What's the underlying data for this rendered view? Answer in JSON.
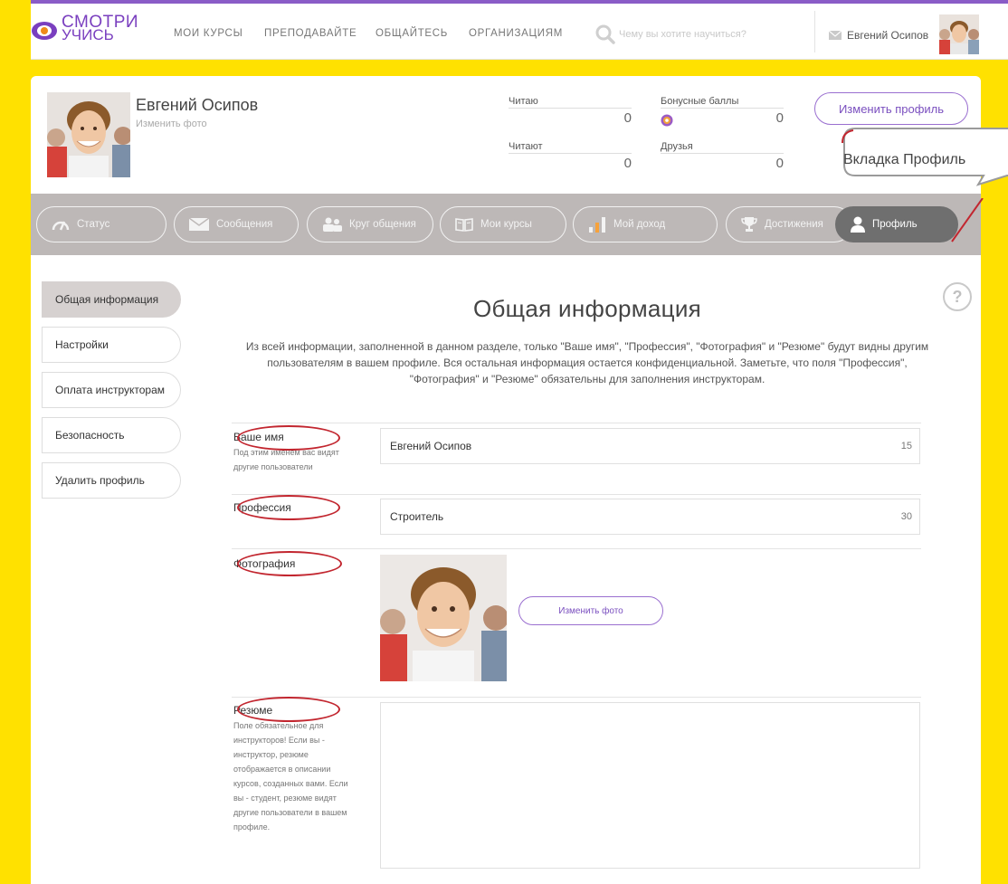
{
  "logo": {
    "line1": "СМОТРИ",
    "line2": "УЧИСЬ"
  },
  "nav": {
    "items": [
      "МОИ КУРСЫ",
      "ПРЕПОДАВАЙТЕ",
      "ОБЩАЙТЕСЬ",
      "ОРГАНИЗАЦИЯМ"
    ]
  },
  "search": {
    "placeholder": "Чему вы хотите научиться?"
  },
  "header_user": {
    "name": "Евгений Осипов"
  },
  "profile": {
    "name": "Евгений Осипов",
    "change_photo": "Изменить фото",
    "stats": [
      {
        "label": "Читаю",
        "value": "0"
      },
      {
        "label": "Бонусные баллы",
        "value": "0"
      },
      {
        "label": "Читают",
        "value": "0"
      },
      {
        "label": "Друзья",
        "value": "0"
      }
    ],
    "edit_button": "Изменить профиль"
  },
  "callout": {
    "text": "Вкладка Профиль"
  },
  "tabs": [
    {
      "label": "Статус",
      "icon": "speedometer-icon",
      "active": false
    },
    {
      "label": "Сообщения",
      "icon": "envelope-icon",
      "active": false
    },
    {
      "label": "Круг общения",
      "icon": "people-icon",
      "active": false
    },
    {
      "label": "Мои курсы",
      "icon": "book-icon",
      "active": false
    },
    {
      "label": "Мой доход",
      "icon": "bars-icon",
      "active": false
    },
    {
      "label": "Достижения",
      "icon": "trophy-icon",
      "active": false
    },
    {
      "label": "Профиль",
      "icon": "person-icon",
      "active": true
    }
  ],
  "sidebar": {
    "items": [
      {
        "label": "Общая информация",
        "active": true
      },
      {
        "label": "Настройки",
        "active": false
      },
      {
        "label": "Оплата инструкторам",
        "active": false
      },
      {
        "label": "Безопасность",
        "active": false
      },
      {
        "label": "Удалить профиль",
        "active": false
      }
    ]
  },
  "main": {
    "title": "Общая информация",
    "intro": "Из всей информации, заполненной в данном разделе, только \"Ваше имя\", \"Профессия\", \"Фотография\" и \"Резюме\" будут видны другим пользователям в вашем профиле. Вся остальная информация остается конфиденциальной. Заметьте, что поля \"Профессия\", \"Фотография\" и \"Резюме\" обязательны для заполнения инструкторам."
  },
  "form": {
    "name": {
      "label": "Ваше имя",
      "hint": "Под этим именем вас видят другие пользователи",
      "value": "Евгений Осипов",
      "counter": "15"
    },
    "profession": {
      "label": "Профессия",
      "value": "Строитель",
      "counter": "30"
    },
    "photo": {
      "label": "Фотография",
      "button": "Изменить фото"
    },
    "resume": {
      "label": "Резюме",
      "hint": "Поле обязательное для инструкторов! Если вы - инструктор, резюме отображается в описании курсов, созданных вами. Если вы - студент, резюме видят другие пользователи в вашем профиле.",
      "value": ""
    }
  },
  "colors": {
    "accent": "#7a3fbf",
    "tabbar": "#bdb8b7",
    "annotation_frame": "#ffe100",
    "annotation_oval": "#c2262f"
  }
}
